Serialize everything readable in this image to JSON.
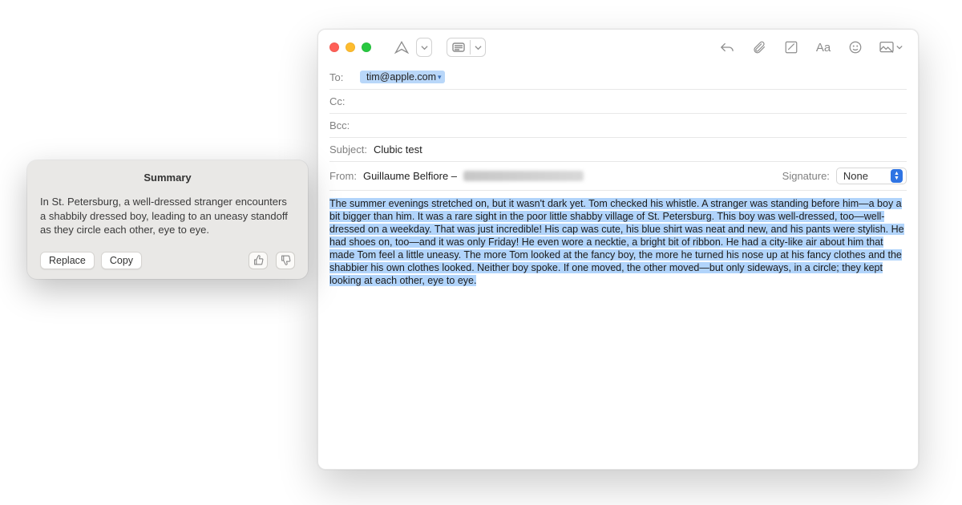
{
  "compose": {
    "to_label": "To:",
    "to_recipient": "tim@apple.com",
    "cc_label": "Cc:",
    "bcc_label": "Bcc:",
    "subject_label": "Subject:",
    "subject_value": "Clubic test",
    "from_label": "From:",
    "from_name": "Guillaume Belfiore –",
    "signature_label": "Signature:",
    "signature_value": "None",
    "body": "The summer evenings stretched on, but it wasn't dark yet. Tom checked his whistle. A stranger was standing before him—a boy a bit bigger than him. It was a rare sight in the poor little shabby village of St. Petersburg. This boy was well-dressed, too—well-dressed on a weekday. That was just incredible! His cap was cute, his blue shirt was neat and new, and his pants were stylish. He had shoes on, too—and it was only Friday! He even wore a necktie, a bright bit of ribbon. He had a city-like air about him that made Tom feel a little uneasy. The more Tom looked at the fancy boy, the more he turned his nose up at his fancy clothes and the shabbier his own clothes looked. Neither boy spoke. If one moved, the other moved—but only sideways, in a circle; they kept looking at each other, eye to eye."
  },
  "toolbar": {
    "icons": {
      "send": "send-icon",
      "header_dropdown": "header-fields-icon",
      "reply": "reply-icon",
      "attach": "paperclip-icon",
      "markup": "markup-icon",
      "format": "format-icon",
      "format_label": "Aa",
      "emoji": "emoji-icon",
      "media": "media-icon"
    }
  },
  "popover": {
    "title": "Summary",
    "text": "In St. Petersburg, a well-dressed stranger encounters a shabbily dressed boy, leading to an uneasy standoff as they circle each other, eye to eye.",
    "replace_label": "Replace",
    "copy_label": "Copy"
  }
}
